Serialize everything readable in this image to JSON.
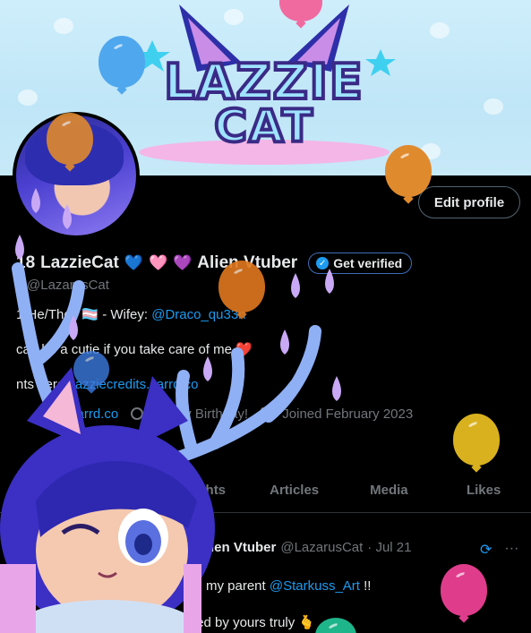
{
  "banner": {
    "logo_line1": "LAZZIE",
    "logo_line2": "CAT"
  },
  "actions": {
    "edit_profile": "Edit profile"
  },
  "profile": {
    "display_name": "LazzieCat",
    "name_prefix": "18",
    "hearts": [
      "💙",
      "🩷",
      "💜"
    ],
    "name_suffix": "Alien Vtuber",
    "get_verified": "Get verified",
    "handle": "@LazarusCat",
    "bio_line1_prefix": "1 He/They 🏳️‍⚧️ - Wifey:",
    "bio_line1_link": "@Draco_qu33n",
    "bio_line2": "can be a cutie if you take care of me ❤️",
    "bio_line3_prefix": "nts here!",
    "bio_line3_link": "lazziecredits.carrd.co",
    "meta_link": "carrd.co",
    "meta_birthday": "Happy Birthday!",
    "meta_joined": "Joined February 2023"
  },
  "tabs": [
    {
      "label": "ghlights"
    },
    {
      "label": "Articles"
    },
    {
      "label": "Media"
    },
    {
      "label": "Likes"
    }
  ],
  "post": {
    "author_name": "Alien Vtuber",
    "author_handle": "@LazarusCat",
    "date": "· Jul 21",
    "line1_prefix": "my parent",
    "line1_link": "@Starkuss_Art",
    "line1_suffix": "!!",
    "line2": "designed by yours truly 🫰"
  },
  "colors": {
    "accent": "#1d9bf0",
    "background": "#000000",
    "muted": "#71767b",
    "banner": "#c7e9f8"
  },
  "icons": [
    "verified-badge-icon",
    "link-icon",
    "balloon-icon",
    "calendar-icon",
    "retweet-icon",
    "more-icon"
  ]
}
